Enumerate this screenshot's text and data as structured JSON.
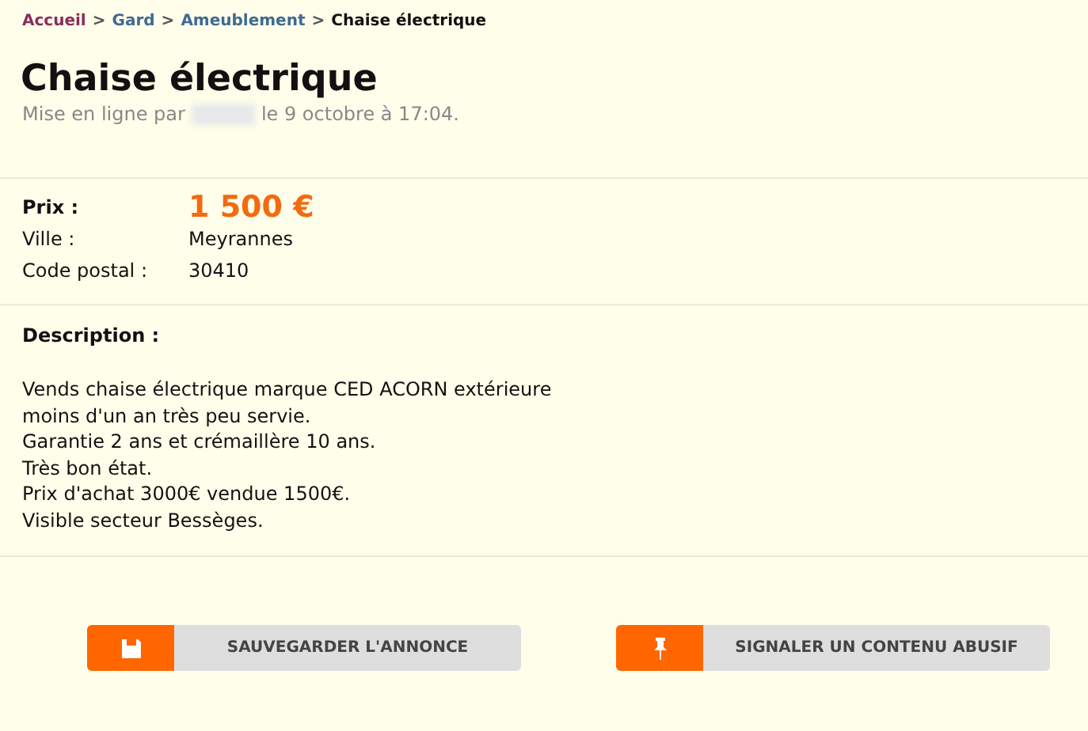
{
  "breadcrumb": [
    {
      "label": "Accueil",
      "color": "#8a2c5c"
    },
    {
      "label": "Gard",
      "color": "#3f6a92"
    },
    {
      "label": "Ameublement",
      "color": "#3f6a92"
    },
    {
      "label": "Chaise électrique",
      "color": "#111111"
    }
  ],
  "separator": ">",
  "title": "Chaise électrique",
  "posted": {
    "prefix": "Mise en ligne par",
    "suffix": "le 9 octobre à 17:04."
  },
  "price": {
    "label": "Prix :",
    "value": "1 500 €"
  },
  "details": [
    {
      "label": "Ville :",
      "value": "Meyrannes"
    },
    {
      "label": "Code postal :",
      "value": "30410"
    }
  ],
  "description": {
    "label": "Description :",
    "lines": [
      "Vends chaise électrique marque CED ACORN extérieure",
      "moins d'un an très peu servie.",
      "Garantie 2 ans et crémaillère 10 ans.",
      "Très bon état.",
      "Prix d'achat 3000€ vendue 1500€.",
      "Visible secteur Bessèges."
    ]
  },
  "buttons": [
    {
      "label": "SAUVEGARDER L'ANNONCE",
      "kind": "save"
    },
    {
      "label": "SIGNALER UN CONTENU ABUSIF",
      "kind": "report"
    }
  ]
}
